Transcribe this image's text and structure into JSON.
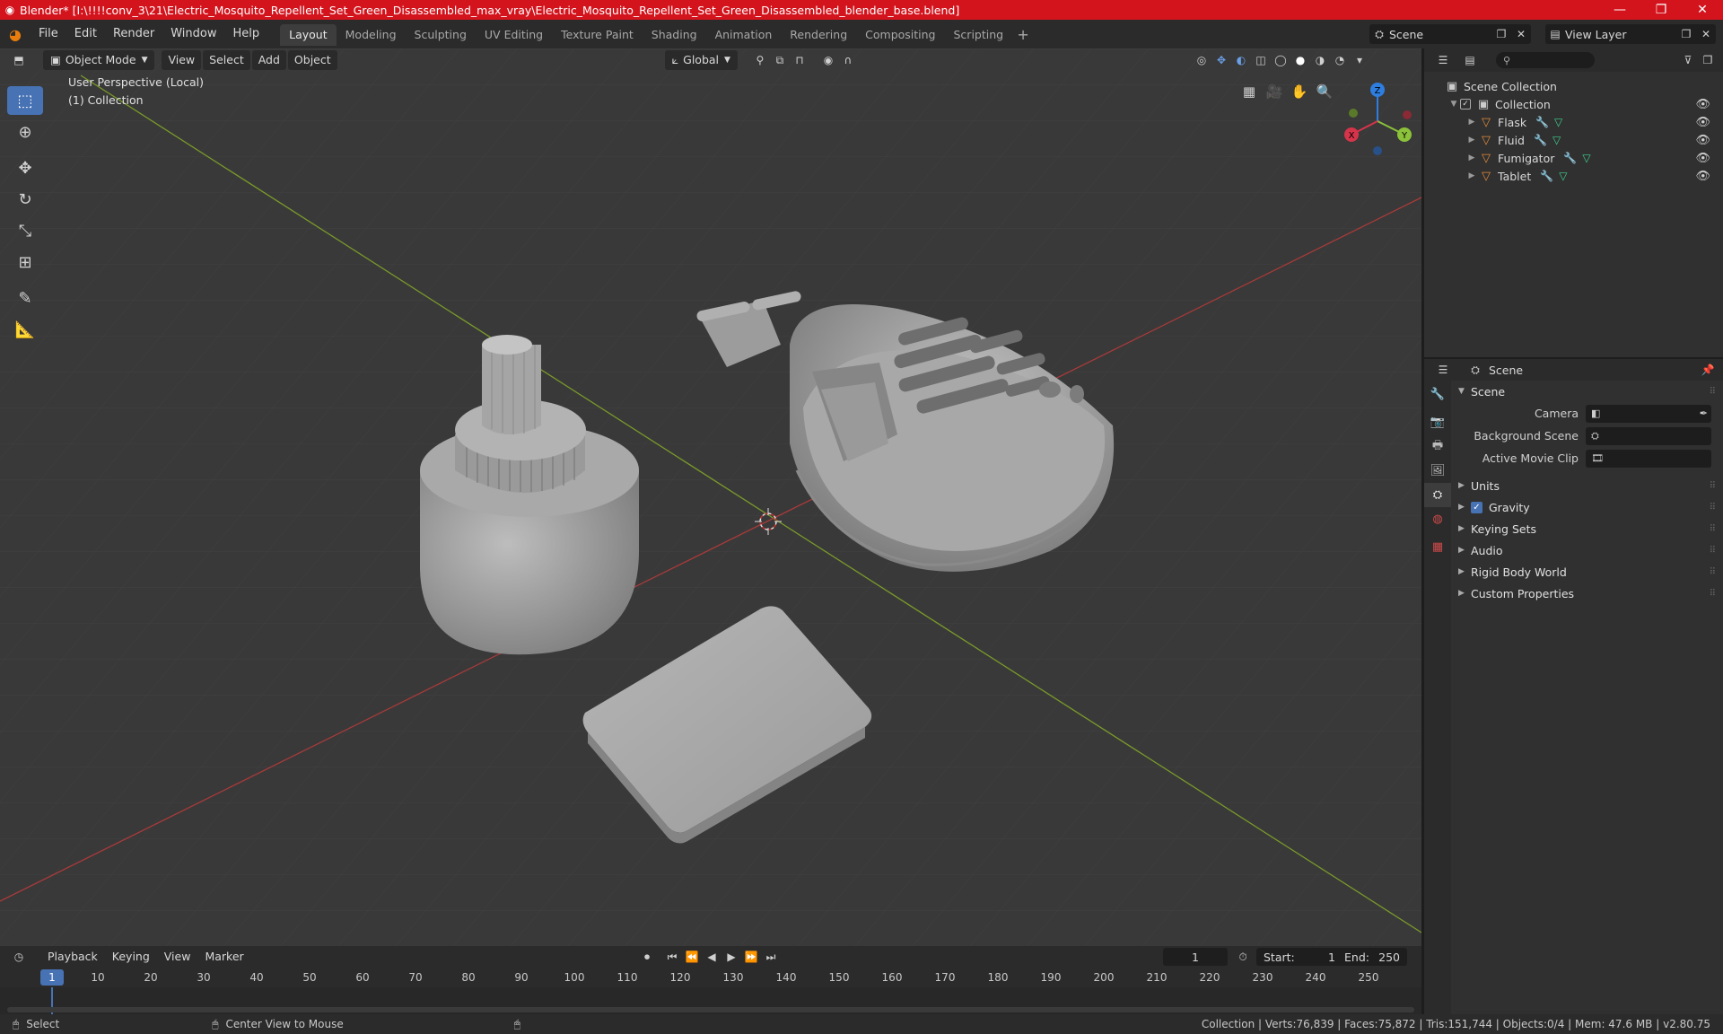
{
  "window": {
    "title": "Blender* [I:\\!!!!conv_3\\21\\Electric_Mosquito_Repellent_Set_Green_Disassembled_max_vray\\Electric_Mosquito_Repellent_Set_Green_Disassembled_blender_base.blend]",
    "minimize": "—",
    "maximize": "❐",
    "close": "✕"
  },
  "menu": {
    "file": "File",
    "edit": "Edit",
    "render": "Render",
    "window": "Window",
    "help": "Help"
  },
  "workspaces": [
    "Layout",
    "Modeling",
    "Sculpting",
    "UV Editing",
    "Texture Paint",
    "Shading",
    "Animation",
    "Rendering",
    "Compositing",
    "Scripting"
  ],
  "workspace_add": "+",
  "scene": {
    "name": "Scene",
    "view_layer": "View Layer"
  },
  "viewport": {
    "mode": "Object Mode",
    "menus": {
      "view": "View",
      "select": "Select",
      "add": "Add",
      "object": "Object"
    },
    "orientation": "Global",
    "info_line1": "User Perspective (Local)",
    "info_line2": "(1) Collection",
    "gizmo": {
      "x": "X",
      "y": "Y",
      "z": "Z"
    }
  },
  "outliner": {
    "root": "Scene Collection",
    "collection": "Collection",
    "objects": [
      "Flask",
      "Fluid",
      "Fumigator",
      "Tablet"
    ]
  },
  "properties": {
    "header": "Scene",
    "panel": "Scene",
    "camera_label": "Camera",
    "background_scene_label": "Background Scene",
    "active_movie_clip_label": "Active Movie Clip",
    "sections": {
      "units": "Units",
      "gravity": "Gravity",
      "keying_sets": "Keying Sets",
      "audio": "Audio",
      "rigid_body_world": "Rigid Body World",
      "custom_properties": "Custom Properties"
    }
  },
  "timeline": {
    "menus": {
      "playback": "Playback",
      "keying": "Keying",
      "view": "View",
      "marker": "Marker"
    },
    "current_frame": "1",
    "start_label": "Start:",
    "start_value": "1",
    "end_label": "End:",
    "end_value": "250",
    "ruler_current": "1",
    "ruler_ticks": [
      "10",
      "20",
      "30",
      "40",
      "50",
      "60",
      "70",
      "80",
      "90",
      "100",
      "110",
      "120",
      "130",
      "140",
      "150",
      "160",
      "170",
      "180",
      "190",
      "200",
      "210",
      "220",
      "230",
      "240",
      "250"
    ]
  },
  "status": {
    "select": "Select",
    "center_view": "Center View to Mouse",
    "stats": "Collection | Verts:76,839 | Faces:75,872 | Tris:151,744 | Objects:0/4 | Mem: 47.6 MB | v2.80.75"
  },
  "colors": {
    "accent": "#4772b3",
    "titlebar": "#d3141d",
    "viewport": "#393939",
    "object_icon": "#e08a3a"
  }
}
